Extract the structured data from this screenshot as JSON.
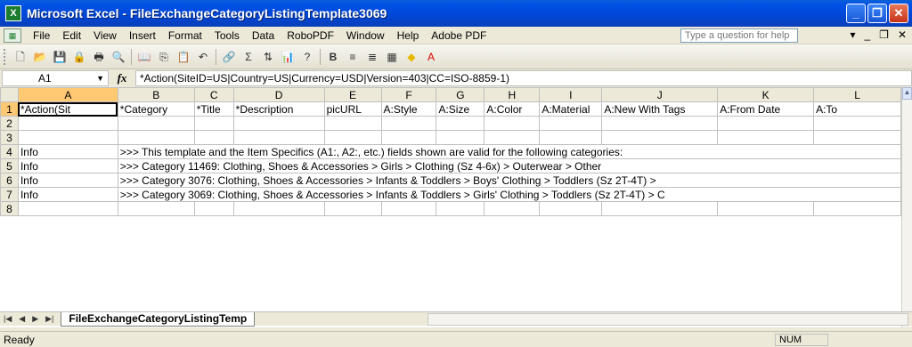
{
  "window": {
    "title": "Microsoft Excel - FileExchangeCategoryListingTemplate3069"
  },
  "menubar": {
    "items": [
      "File",
      "Edit",
      "View",
      "Insert",
      "Format",
      "Tools",
      "Data",
      "RoboPDF",
      "Window",
      "Help",
      "Adobe PDF"
    ],
    "help_placeholder": "Type a question for help"
  },
  "formula": {
    "cell_ref": "A1",
    "fx": "fx",
    "content": "*Action(SiteID=US|Country=US|Currency=USD|Version=403|CC=ISO-8859-1)"
  },
  "grid": {
    "columns": [
      "A",
      "B",
      "C",
      "D",
      "E",
      "F",
      "G",
      "H",
      "I",
      "J",
      "K",
      "L"
    ],
    "row_numbers": [
      "1",
      "2",
      "3",
      "4",
      "5",
      "6",
      "7",
      "8"
    ],
    "header_row": [
      "*Action(Sit",
      "*Category",
      "*Title",
      "*Description",
      "picURL",
      "A:Style",
      "A:Size",
      "A:Color",
      "A:Material",
      "A:New With Tags",
      "A:From Date",
      "A:To"
    ],
    "info_rows": [
      {
        "a": "Info",
        "b": ">>> This template and the Item Specifics (A1:, A2:, etc.) fields shown are valid for the following categories:"
      },
      {
        "a": "Info",
        "b": ">>> Category 11469: Clothing, Shoes & Accessories > Girls > Clothing (Sz 4-6x) > Outerwear > Other"
      },
      {
        "a": "Info",
        "b": ">>> Category 3076: Clothing, Shoes & Accessories > Infants & Toddlers > Boys' Clothing > Toddlers (Sz 2T-4T) >"
      },
      {
        "a": "Info",
        "b": ">>> Category 3069: Clothing, Shoes & Accessories > Infants & Toddlers > Girls' Clothing > Toddlers (Sz 2T-4T) > C"
      }
    ]
  },
  "sheet_tab": "FileExchangeCategoryListingTemp",
  "status": {
    "left": "Ready",
    "num": "NUM"
  }
}
